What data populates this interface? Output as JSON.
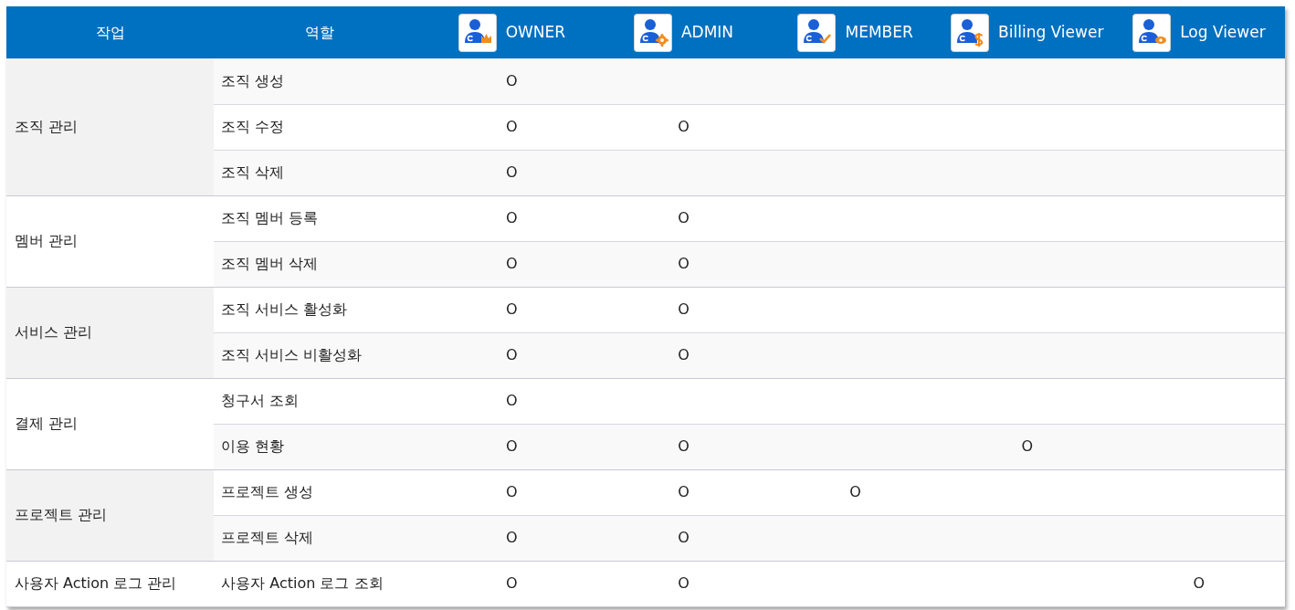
{
  "header": {
    "task": "작업",
    "role": "역할",
    "roles": [
      {
        "label": "OWNER",
        "kind": "owner"
      },
      {
        "label": "ADMIN",
        "kind": "admin"
      },
      {
        "label": "MEMBER",
        "kind": "member"
      },
      {
        "label": "Billing Viewer",
        "kind": "billing"
      },
      {
        "label": "Log Viewer",
        "kind": "log"
      }
    ]
  },
  "groups": [
    {
      "task": "조직 관리",
      "rows": [
        {
          "role": "조직 생성",
          "owner": "O"
        },
        {
          "role": "조직 수정",
          "owner": "O",
          "admin": "O"
        },
        {
          "role": "조직 삭제",
          "owner": "O"
        }
      ]
    },
    {
      "task": "멤버 관리",
      "rows": [
        {
          "role": "조직 멤버 등록",
          "owner": "O",
          "admin": "O"
        },
        {
          "role": "조직 멤버 삭제",
          "owner": "O",
          "admin": "O"
        }
      ]
    },
    {
      "task": "서비스 관리",
      "rows": [
        {
          "role": "조직 서비스 활성화",
          "owner": "O",
          "admin": "O"
        },
        {
          "role": "조직 서비스 비활성화",
          "owner": "O",
          "admin": "O"
        }
      ]
    },
    {
      "task": "결제 관리",
      "rows": [
        {
          "role": "청구서 조회",
          "owner": "O"
        },
        {
          "role": "이용 현황",
          "owner": "O",
          "admin": "O",
          "billing": "O"
        }
      ]
    },
    {
      "task": "프로젝트 관리",
      "rows": [
        {
          "role": "프로젝트 생성",
          "owner": "O",
          "admin": "O",
          "member": "O"
        },
        {
          "role": "프로젝트 삭제",
          "owner": "O",
          "admin": "O"
        }
      ]
    },
    {
      "task": "사용자 Action 로그 관리",
      "rows": [
        {
          "role": "사용자 Action 로그 조회",
          "owner": "O",
          "admin": "O",
          "log": "O"
        }
      ]
    }
  ]
}
